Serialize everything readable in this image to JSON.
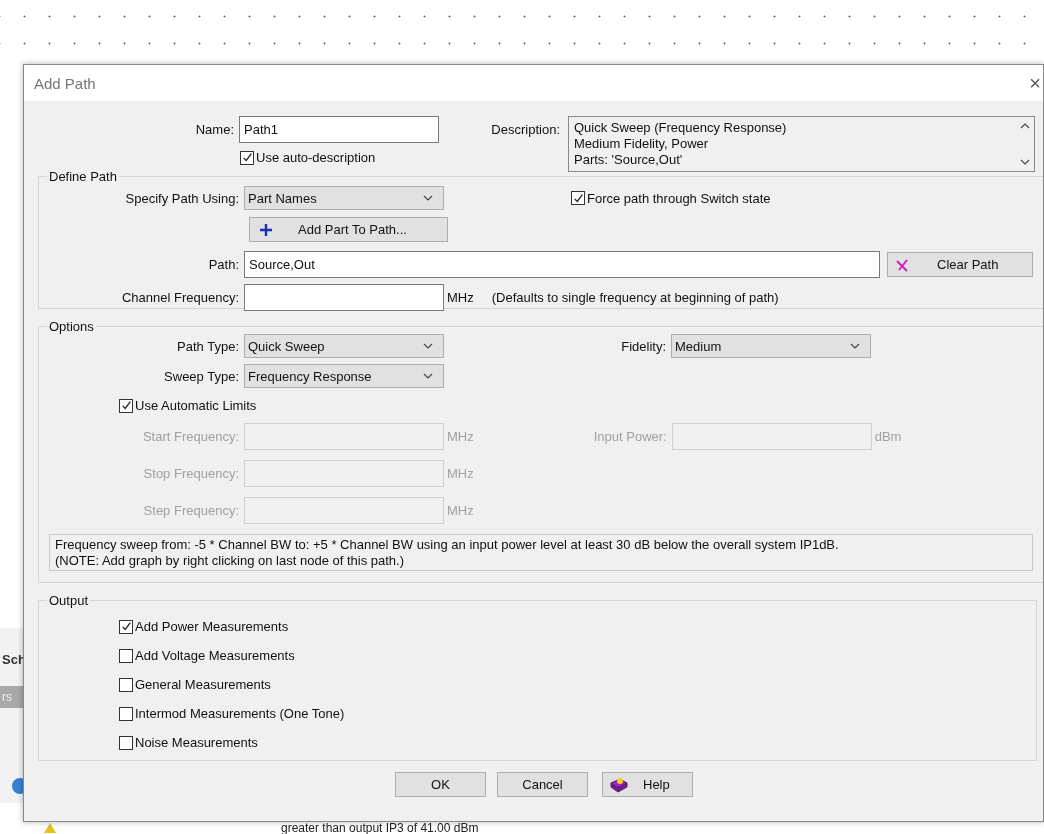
{
  "background": {
    "tab": "Sch",
    "strip": "rs",
    "status": "greater than output IP3 of 41.00 dBm"
  },
  "dialog": {
    "title": "Add Path",
    "close": "×"
  },
  "name": {
    "label": "Name:",
    "value": "Path1"
  },
  "auto_description": {
    "label": "Use auto-description",
    "checked": true
  },
  "description": {
    "label": "Description:",
    "lines": [
      "Quick Sweep (Frequency Response)",
      "Medium Fidelity, Power",
      "Parts: 'Source,Out'"
    ]
  },
  "define_path": {
    "title": "Define Path",
    "specify_label": "Specify Path Using:",
    "specify_value": "Part Names",
    "force_switch": {
      "label": "Force path through Switch state",
      "checked": true
    },
    "add_part_button": "Add Part To Path...",
    "path_label": "Path:",
    "path_value": "Source,Out",
    "clear_button": "Clear Path",
    "channel_label": "Channel Frequency:",
    "channel_unit": "MHz",
    "channel_note": "(Defaults to single frequency at beginning of path)"
  },
  "options": {
    "title": "Options",
    "path_type": {
      "label": "Path Type:",
      "value": "Quick Sweep"
    },
    "sweep_type": {
      "label": "Sweep Type:",
      "value": "Frequency Response"
    },
    "fidelity": {
      "label": "Fidelity:",
      "value": "Medium"
    },
    "auto_limits": {
      "label": "Use Automatic Limits",
      "checked": true
    },
    "limits": [
      {
        "label": "Start Frequency:",
        "unit": "MHz",
        "disabled": true
      },
      {
        "label": "Stop Frequency:",
        "unit": "MHz",
        "disabled": true
      },
      {
        "label": "Step Frequency:",
        "unit": "MHz",
        "disabled": true
      }
    ],
    "input_power": {
      "label": "Input Power:",
      "unit": "dBm",
      "disabled": true
    },
    "note": [
      "Frequency sweep from: -5 * Channel BW to: +5 * Channel BW using an input power level at least 30 dB below the overall system IP1dB.",
      "(NOTE: Add graph by right clicking on last node of this path.)"
    ]
  },
  "output": {
    "title": "Output",
    "items": [
      {
        "label": "Add Power Measurements",
        "checked": true
      },
      {
        "label": "Add Voltage Measurements",
        "checked": false
      },
      {
        "label": "General Measurements",
        "checked": false
      },
      {
        "label": "Intermod Measurements (One Tone)",
        "checked": false
      },
      {
        "label": "Noise Measurements",
        "checked": false
      }
    ]
  },
  "buttons": [
    {
      "label": "OK",
      "kind": "plain"
    },
    {
      "label": "Cancel",
      "kind": "plain"
    },
    {
      "label": "Help",
      "kind": "help"
    }
  ]
}
